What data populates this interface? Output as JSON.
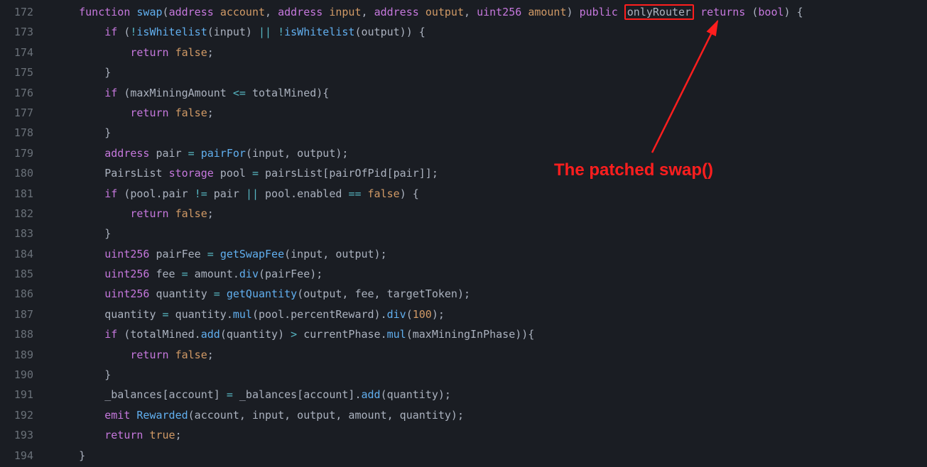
{
  "annotation_text": "The patched swap()",
  "colors": {
    "highlight_box": "#ff1e1e"
  },
  "lines": [
    {
      "num": "172",
      "tokens": [
        {
          "t": "    ",
          "c": "plain"
        },
        {
          "t": "function",
          "c": "kw-fn"
        },
        {
          "t": " ",
          "c": "plain"
        },
        {
          "t": "swap",
          "c": "call"
        },
        {
          "t": "(",
          "c": "punct"
        },
        {
          "t": "address",
          "c": "addr"
        },
        {
          "t": " ",
          "c": "plain"
        },
        {
          "t": "account",
          "c": "param"
        },
        {
          "t": ", ",
          "c": "punct"
        },
        {
          "t": "address",
          "c": "addr"
        },
        {
          "t": " ",
          "c": "plain"
        },
        {
          "t": "input",
          "c": "param"
        },
        {
          "t": ", ",
          "c": "punct"
        },
        {
          "t": "address",
          "c": "addr"
        },
        {
          "t": " ",
          "c": "plain"
        },
        {
          "t": "output",
          "c": "param"
        },
        {
          "t": ", ",
          "c": "punct"
        },
        {
          "t": "uint256",
          "c": "addr"
        },
        {
          "t": " ",
          "c": "plain"
        },
        {
          "t": "amount",
          "c": "param"
        },
        {
          "t": ") ",
          "c": "punct"
        },
        {
          "t": "public",
          "c": "kw-fn"
        },
        {
          "t": " ",
          "c": "plain"
        },
        {
          "t": "onlyRouter",
          "c": "plain",
          "box": true
        },
        {
          "t": " ",
          "c": "plain"
        },
        {
          "t": "returns",
          "c": "kw-fn"
        },
        {
          "t": " (",
          "c": "punct"
        },
        {
          "t": "bool",
          "c": "addr"
        },
        {
          "t": ") {",
          "c": "punct"
        }
      ]
    },
    {
      "num": "173",
      "tokens": [
        {
          "t": "        ",
          "c": "plain"
        },
        {
          "t": "if",
          "c": "kw-fn"
        },
        {
          "t": " (",
          "c": "punct"
        },
        {
          "t": "!",
          "c": "op"
        },
        {
          "t": "isWhitelist",
          "c": "call"
        },
        {
          "t": "(input) ",
          "c": "plain"
        },
        {
          "t": "||",
          "c": "op"
        },
        {
          "t": " ",
          "c": "plain"
        },
        {
          "t": "!",
          "c": "op"
        },
        {
          "t": "isWhitelist",
          "c": "call"
        },
        {
          "t": "(output)) {",
          "c": "plain"
        }
      ]
    },
    {
      "num": "174",
      "tokens": [
        {
          "t": "            ",
          "c": "plain"
        },
        {
          "t": "return",
          "c": "kw-ret"
        },
        {
          "t": " ",
          "c": "plain"
        },
        {
          "t": "false",
          "c": "kw-bool"
        },
        {
          "t": ";",
          "c": "punct"
        }
      ]
    },
    {
      "num": "175",
      "tokens": [
        {
          "t": "        }",
          "c": "plain"
        }
      ]
    },
    {
      "num": "176",
      "tokens": [
        {
          "t": "        ",
          "c": "plain"
        },
        {
          "t": "if",
          "c": "kw-fn"
        },
        {
          "t": " (maxMiningAmount ",
          "c": "plain"
        },
        {
          "t": "<=",
          "c": "op"
        },
        {
          "t": " totalMined){",
          "c": "plain"
        }
      ]
    },
    {
      "num": "177",
      "tokens": [
        {
          "t": "            ",
          "c": "plain"
        },
        {
          "t": "return",
          "c": "kw-ret"
        },
        {
          "t": " ",
          "c": "plain"
        },
        {
          "t": "false",
          "c": "kw-bool"
        },
        {
          "t": ";",
          "c": "punct"
        }
      ]
    },
    {
      "num": "178",
      "tokens": [
        {
          "t": "        }",
          "c": "plain"
        }
      ]
    },
    {
      "num": "179",
      "tokens": [
        {
          "t": "        ",
          "c": "plain"
        },
        {
          "t": "address",
          "c": "addr"
        },
        {
          "t": " pair ",
          "c": "plain"
        },
        {
          "t": "=",
          "c": "op"
        },
        {
          "t": " ",
          "c": "plain"
        },
        {
          "t": "pairFor",
          "c": "call"
        },
        {
          "t": "(input, output);",
          "c": "plain"
        }
      ]
    },
    {
      "num": "180",
      "tokens": [
        {
          "t": "        PairsList ",
          "c": "plain"
        },
        {
          "t": "storage",
          "c": "storage"
        },
        {
          "t": " pool ",
          "c": "plain"
        },
        {
          "t": "=",
          "c": "op"
        },
        {
          "t": " pairsList[pairOfPid[pair]];",
          "c": "plain"
        }
      ]
    },
    {
      "num": "181",
      "tokens": [
        {
          "t": "        ",
          "c": "plain"
        },
        {
          "t": "if",
          "c": "kw-fn"
        },
        {
          "t": " (pool.pair ",
          "c": "plain"
        },
        {
          "t": "!=",
          "c": "op"
        },
        {
          "t": " pair ",
          "c": "plain"
        },
        {
          "t": "||",
          "c": "op"
        },
        {
          "t": " pool.enabled ",
          "c": "plain"
        },
        {
          "t": "==",
          "c": "op"
        },
        {
          "t": " ",
          "c": "plain"
        },
        {
          "t": "false",
          "c": "kw-bool"
        },
        {
          "t": ") {",
          "c": "plain"
        }
      ]
    },
    {
      "num": "182",
      "tokens": [
        {
          "t": "            ",
          "c": "plain"
        },
        {
          "t": "return",
          "c": "kw-ret"
        },
        {
          "t": " ",
          "c": "plain"
        },
        {
          "t": "false",
          "c": "kw-bool"
        },
        {
          "t": ";",
          "c": "punct"
        }
      ]
    },
    {
      "num": "183",
      "tokens": [
        {
          "t": "        }",
          "c": "plain"
        }
      ]
    },
    {
      "num": "184",
      "tokens": [
        {
          "t": "        ",
          "c": "plain"
        },
        {
          "t": "uint256",
          "c": "addr"
        },
        {
          "t": " pairFee ",
          "c": "plain"
        },
        {
          "t": "=",
          "c": "op"
        },
        {
          "t": " ",
          "c": "plain"
        },
        {
          "t": "getSwapFee",
          "c": "call"
        },
        {
          "t": "(input, output);",
          "c": "plain"
        }
      ]
    },
    {
      "num": "185",
      "tokens": [
        {
          "t": "        ",
          "c": "plain"
        },
        {
          "t": "uint256",
          "c": "addr"
        },
        {
          "t": " fee ",
          "c": "plain"
        },
        {
          "t": "=",
          "c": "op"
        },
        {
          "t": " amount.",
          "c": "plain"
        },
        {
          "t": "div",
          "c": "call"
        },
        {
          "t": "(pairFee);",
          "c": "plain"
        }
      ]
    },
    {
      "num": "186",
      "tokens": [
        {
          "t": "        ",
          "c": "plain"
        },
        {
          "t": "uint256",
          "c": "addr"
        },
        {
          "t": " quantity ",
          "c": "plain"
        },
        {
          "t": "=",
          "c": "op"
        },
        {
          "t": " ",
          "c": "plain"
        },
        {
          "t": "getQuantity",
          "c": "call"
        },
        {
          "t": "(output, fee, targetToken);",
          "c": "plain"
        }
      ]
    },
    {
      "num": "187",
      "tokens": [
        {
          "t": "        quantity ",
          "c": "plain"
        },
        {
          "t": "=",
          "c": "op"
        },
        {
          "t": " quantity.",
          "c": "plain"
        },
        {
          "t": "mul",
          "c": "call"
        },
        {
          "t": "(pool.percentReward).",
          "c": "plain"
        },
        {
          "t": "div",
          "c": "call"
        },
        {
          "t": "(",
          "c": "plain"
        },
        {
          "t": "100",
          "c": "num"
        },
        {
          "t": ");",
          "c": "plain"
        }
      ]
    },
    {
      "num": "188",
      "tokens": [
        {
          "t": "        ",
          "c": "plain"
        },
        {
          "t": "if",
          "c": "kw-fn"
        },
        {
          "t": " (totalMined.",
          "c": "plain"
        },
        {
          "t": "add",
          "c": "call"
        },
        {
          "t": "(quantity) ",
          "c": "plain"
        },
        {
          "t": ">",
          "c": "op"
        },
        {
          "t": " currentPhase.",
          "c": "plain"
        },
        {
          "t": "mul",
          "c": "call"
        },
        {
          "t": "(maxMiningInPhase)){",
          "c": "plain"
        }
      ]
    },
    {
      "num": "189",
      "tokens": [
        {
          "t": "            ",
          "c": "plain"
        },
        {
          "t": "return",
          "c": "kw-ret"
        },
        {
          "t": " ",
          "c": "plain"
        },
        {
          "t": "false",
          "c": "kw-bool"
        },
        {
          "t": ";",
          "c": "punct"
        }
      ]
    },
    {
      "num": "190",
      "tokens": [
        {
          "t": "        }",
          "c": "plain"
        }
      ]
    },
    {
      "num": "191",
      "tokens": [
        {
          "t": "        _balances[account] ",
          "c": "plain"
        },
        {
          "t": "=",
          "c": "op"
        },
        {
          "t": " _balances[account].",
          "c": "plain"
        },
        {
          "t": "add",
          "c": "call"
        },
        {
          "t": "(quantity);",
          "c": "plain"
        }
      ]
    },
    {
      "num": "192",
      "tokens": [
        {
          "t": "        ",
          "c": "plain"
        },
        {
          "t": "emit",
          "c": "kw-emit"
        },
        {
          "t": " ",
          "c": "plain"
        },
        {
          "t": "Rewarded",
          "c": "call"
        },
        {
          "t": "(account, input, output, amount, quantity);",
          "c": "plain"
        }
      ]
    },
    {
      "num": "193",
      "tokens": [
        {
          "t": "        ",
          "c": "plain"
        },
        {
          "t": "return",
          "c": "kw-ret"
        },
        {
          "t": " ",
          "c": "plain"
        },
        {
          "t": "true",
          "c": "kw-bool"
        },
        {
          "t": ";",
          "c": "punct"
        }
      ]
    },
    {
      "num": "194",
      "tokens": [
        {
          "t": "    }",
          "c": "plain"
        }
      ]
    }
  ]
}
